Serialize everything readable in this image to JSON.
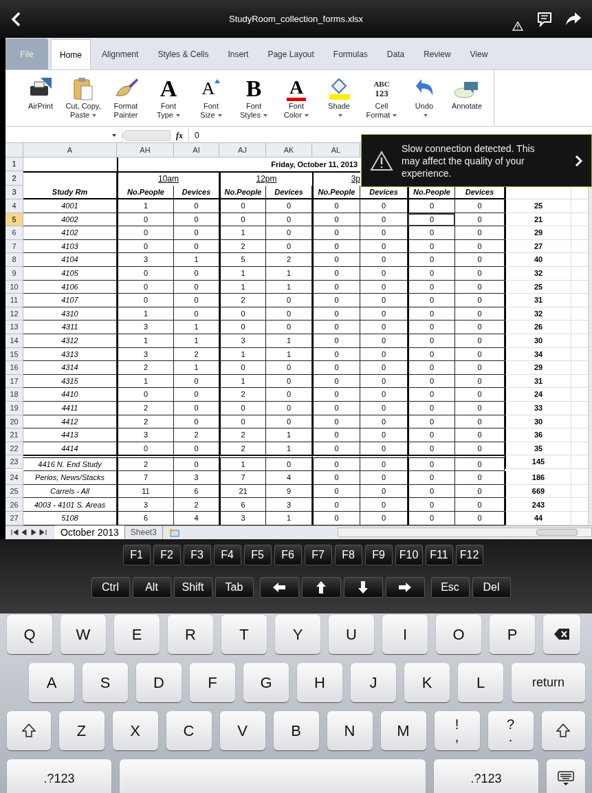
{
  "window": {
    "title": "StudyRoom_collection_forms.xlsx"
  },
  "tabs": [
    {
      "label": "File",
      "kind": "file",
      "selected": false
    },
    {
      "label": "Home",
      "kind": "tab",
      "selected": true
    },
    {
      "label": "Alignment",
      "kind": "tab",
      "selected": false
    },
    {
      "label": "Styles & Cells",
      "kind": "tab",
      "selected": false
    },
    {
      "label": "Insert",
      "kind": "tab",
      "selected": false
    },
    {
      "label": "Page Layout",
      "kind": "tab",
      "selected": false
    },
    {
      "label": "Formulas",
      "kind": "tab",
      "selected": false
    },
    {
      "label": "Data",
      "kind": "tab",
      "selected": false
    },
    {
      "label": "Review",
      "kind": "tab",
      "selected": false
    },
    {
      "label": "View",
      "kind": "tab",
      "selected": false
    }
  ],
  "ribbon": [
    {
      "kind": "printer",
      "lines": [
        "AirPrint"
      ],
      "dropdown": false
    },
    {
      "kind": "clipboard",
      "lines": [
        "Cut, Copy,",
        "Paste"
      ],
      "dropdown": true
    },
    {
      "kind": "brush",
      "lines": [
        "Format",
        "Painter"
      ],
      "dropdown": false
    },
    {
      "kind": "glyph",
      "glyph": "A",
      "lines": [
        "Font",
        "Type"
      ],
      "dropdown": true
    },
    {
      "kind": "size",
      "glyph": "A",
      "lines": [
        "Font",
        "Size"
      ],
      "dropdown": true
    },
    {
      "kind": "glyph",
      "glyph": "B",
      "lines": [
        "Font",
        "Styles"
      ],
      "dropdown": true
    },
    {
      "kind": "color",
      "glyph": "A",
      "lines": [
        "Font",
        "Color"
      ],
      "dropdown": true
    },
    {
      "kind": "shade",
      "lines": [
        "Shade"
      ],
      "dropdown": true
    },
    {
      "kind": "format",
      "glyph": "ABC",
      "glyph2": "123",
      "lines": [
        "Cell",
        "Format"
      ],
      "dropdown": true
    },
    {
      "kind": "undo",
      "lines": [
        "Undo"
      ],
      "dropdown": true
    },
    {
      "kind": "annotate",
      "lines": [
        "Annotate"
      ],
      "dropdown": false
    }
  ],
  "formula_bar": {
    "function_symbol": "fx",
    "value": "0"
  },
  "columns": [
    "A",
    "AH",
    "AI",
    "AJ",
    "AK",
    "AL"
  ],
  "header_rows": [
    {
      "number": "1",
      "title": "Friday, October 11, 2013"
    },
    {
      "number": "2",
      "times": [
        "10am",
        "12pm",
        "3p"
      ]
    },
    {
      "number": "3",
      "room_heading": "Study Rm",
      "headings": [
        "No.People",
        "Devices",
        "No.People",
        "Devices",
        "No.People",
        "Devices",
        "No.People",
        "Devices"
      ]
    }
  ],
  "rows": [
    {
      "number": "4",
      "selected": false,
      "section_start": false,
      "room": "4001",
      "total": "25",
      "cells": [
        {
          "value": "1",
          "selected": false
        },
        {
          "value": "0",
          "selected": false
        },
        {
          "value": "0",
          "selected": false
        },
        {
          "value": "0",
          "selected": false
        },
        {
          "value": "0",
          "selected": false
        },
        {
          "value": "0",
          "selected": false
        },
        {
          "value": "0",
          "selected": false
        },
        {
          "value": "0",
          "selected": false
        }
      ]
    },
    {
      "number": "5",
      "selected": true,
      "section_start": false,
      "room": "4002",
      "total": "21",
      "cells": [
        {
          "value": "0",
          "selected": false
        },
        {
          "value": "0",
          "selected": false
        },
        {
          "value": "0",
          "selected": false
        },
        {
          "value": "0",
          "selected": false
        },
        {
          "value": "0",
          "selected": false
        },
        {
          "value": "0",
          "selected": false
        },
        {
          "value": "0",
          "selected": true
        },
        {
          "value": "0",
          "selected": false
        }
      ]
    },
    {
      "number": "6",
      "selected": false,
      "section_start": false,
      "room": "4102",
      "total": "29",
      "cells": [
        {
          "value": "0",
          "selected": false
        },
        {
          "value": "0",
          "selected": false
        },
        {
          "value": "1",
          "selected": false
        },
        {
          "value": "0",
          "selected": false
        },
        {
          "value": "0",
          "selected": false
        },
        {
          "value": "0",
          "selected": false
        },
        {
          "value": "0",
          "selected": false
        },
        {
          "value": "0",
          "selected": false
        }
      ]
    },
    {
      "number": "7",
      "selected": false,
      "section_start": false,
      "room": "4103",
      "total": "27",
      "cells": [
        {
          "value": "0",
          "selected": false
        },
        {
          "value": "0",
          "selected": false
        },
        {
          "value": "2",
          "selected": false
        },
        {
          "value": "0",
          "selected": false
        },
        {
          "value": "0",
          "selected": false
        },
        {
          "value": "0",
          "selected": false
        },
        {
          "value": "0",
          "selected": false
        },
        {
          "value": "0",
          "selected": false
        }
      ]
    },
    {
      "number": "8",
      "selected": false,
      "section_start": false,
      "room": "4104",
      "total": "40",
      "cells": [
        {
          "value": "3",
          "selected": false
        },
        {
          "value": "1",
          "selected": false
        },
        {
          "value": "5",
          "selected": false
        },
        {
          "value": "2",
          "selected": false
        },
        {
          "value": "0",
          "selected": false
        },
        {
          "value": "0",
          "selected": false
        },
        {
          "value": "0",
          "selected": false
        },
        {
          "value": "0",
          "selected": false
        }
      ]
    },
    {
      "number": "9",
      "selected": false,
      "section_start": false,
      "room": "4105",
      "total": "32",
      "cells": [
        {
          "value": "0",
          "selected": false
        },
        {
          "value": "0",
          "selected": false
        },
        {
          "value": "1",
          "selected": false
        },
        {
          "value": "1",
          "selected": false
        },
        {
          "value": "0",
          "selected": false
        },
        {
          "value": "0",
          "selected": false
        },
        {
          "value": "0",
          "selected": false
        },
        {
          "value": "0",
          "selected": false
        }
      ]
    },
    {
      "number": "10",
      "selected": false,
      "section_start": false,
      "room": "4106",
      "total": "25",
      "cells": [
        {
          "value": "0",
          "selected": false
        },
        {
          "value": "0",
          "selected": false
        },
        {
          "value": "1",
          "selected": false
        },
        {
          "value": "1",
          "selected": false
        },
        {
          "value": "0",
          "selected": false
        },
        {
          "value": "0",
          "selected": false
        },
        {
          "value": "0",
          "selected": false
        },
        {
          "value": "0",
          "selected": false
        }
      ]
    },
    {
      "number": "11",
      "selected": false,
      "section_start": false,
      "room": "4107",
      "total": "31",
      "cells": [
        {
          "value": "0",
          "selected": false
        },
        {
          "value": "0",
          "selected": false
        },
        {
          "value": "2",
          "selected": false
        },
        {
          "value": "0",
          "selected": false
        },
        {
          "value": "0",
          "selected": false
        },
        {
          "value": "0",
          "selected": false
        },
        {
          "value": "0",
          "selected": false
        },
        {
          "value": "0",
          "selected": false
        }
      ]
    },
    {
      "number": "12",
      "selected": false,
      "section_start": false,
      "room": "4310",
      "total": "32",
      "cells": [
        {
          "value": "1",
          "selected": false
        },
        {
          "value": "0",
          "selected": false
        },
        {
          "value": "0",
          "selected": false
        },
        {
          "value": "0",
          "selected": false
        },
        {
          "value": "0",
          "selected": false
        },
        {
          "value": "0",
          "selected": false
        },
        {
          "value": "0",
          "selected": false
        },
        {
          "value": "0",
          "selected": false
        }
      ]
    },
    {
      "number": "13",
      "selected": false,
      "section_start": false,
      "room": "4311",
      "total": "26",
      "cells": [
        {
          "value": "3",
          "selected": false
        },
        {
          "value": "1",
          "selected": false
        },
        {
          "value": "0",
          "selected": false
        },
        {
          "value": "0",
          "selected": false
        },
        {
          "value": "0",
          "selected": false
        },
        {
          "value": "0",
          "selected": false
        },
        {
          "value": "0",
          "selected": false
        },
        {
          "value": "0",
          "selected": false
        }
      ]
    },
    {
      "number": "14",
      "selected": false,
      "section_start": false,
      "room": "4312",
      "total": "30",
      "cells": [
        {
          "value": "1",
          "selected": false
        },
        {
          "value": "1",
          "selected": false
        },
        {
          "value": "3",
          "selected": false
        },
        {
          "value": "1",
          "selected": false
        },
        {
          "value": "0",
          "selected": false
        },
        {
          "value": "0",
          "selected": false
        },
        {
          "value": "0",
          "selected": false
        },
        {
          "value": "0",
          "selected": false
        }
      ]
    },
    {
      "number": "15",
      "selected": false,
      "section_start": false,
      "room": "4313",
      "total": "34",
      "cells": [
        {
          "value": "3",
          "selected": false
        },
        {
          "value": "2",
          "selected": false
        },
        {
          "value": "1",
          "selected": false
        },
        {
          "value": "1",
          "selected": false
        },
        {
          "value": "0",
          "selected": false
        },
        {
          "value": "0",
          "selected": false
        },
        {
          "value": "0",
          "selected": false
        },
        {
          "value": "0",
          "selected": false
        }
      ]
    },
    {
      "number": "16",
      "selected": false,
      "section_start": false,
      "room": "4314",
      "total": "29",
      "cells": [
        {
          "value": "2",
          "selected": false
        },
        {
          "value": "1",
          "selected": false
        },
        {
          "value": "0",
          "selected": false
        },
        {
          "value": "0",
          "selected": false
        },
        {
          "value": "0",
          "selected": false
        },
        {
          "value": "0",
          "selected": false
        },
        {
          "value": "0",
          "selected": false
        },
        {
          "value": "0",
          "selected": false
        }
      ]
    },
    {
      "number": "17",
      "selected": false,
      "section_start": false,
      "room": "4315",
      "total": "31",
      "cells": [
        {
          "value": "1",
          "selected": false
        },
        {
          "value": "0",
          "selected": false
        },
        {
          "value": "1",
          "selected": false
        },
        {
          "value": "0",
          "selected": false
        },
        {
          "value": "0",
          "selected": false
        },
        {
          "value": "0",
          "selected": false
        },
        {
          "value": "0",
          "selected": false
        },
        {
          "value": "0",
          "selected": false
        }
      ]
    },
    {
      "number": "18",
      "selected": false,
      "section_start": false,
      "room": "4410",
      "total": "24",
      "cells": [
        {
          "value": "0",
          "selected": false
        },
        {
          "value": "0",
          "selected": false
        },
        {
          "value": "2",
          "selected": false
        },
        {
          "value": "0",
          "selected": false
        },
        {
          "value": "0",
          "selected": false
        },
        {
          "value": "0",
          "selected": false
        },
        {
          "value": "0",
          "selected": false
        },
        {
          "value": "0",
          "selected": false
        }
      ]
    },
    {
      "number": "19",
      "selected": false,
      "section_start": false,
      "room": "4411",
      "total": "33",
      "cells": [
        {
          "value": "2",
          "selected": false
        },
        {
          "value": "0",
          "selected": false
        },
        {
          "value": "0",
          "selected": false
        },
        {
          "value": "0",
          "selected": false
        },
        {
          "value": "0",
          "selected": false
        },
        {
          "value": "0",
          "selected": false
        },
        {
          "value": "0",
          "selected": false
        },
        {
          "value": "0",
          "selected": false
        }
      ]
    },
    {
      "number": "20",
      "selected": false,
      "section_start": false,
      "room": "4412",
      "total": "30",
      "cells": [
        {
          "value": "2",
          "selected": false
        },
        {
          "value": "0",
          "selected": false
        },
        {
          "value": "0",
          "selected": false
        },
        {
          "value": "0",
          "selected": false
        },
        {
          "value": "0",
          "selected": false
        },
        {
          "value": "0",
          "selected": false
        },
        {
          "value": "0",
          "selected": false
        },
        {
          "value": "0",
          "selected": false
        }
      ]
    },
    {
      "number": "21",
      "selected": false,
      "section_start": false,
      "room": "4413",
      "total": "36",
      "cells": [
        {
          "value": "3",
          "selected": false
        },
        {
          "value": "2",
          "selected": false
        },
        {
          "value": "2",
          "selected": false
        },
        {
          "value": "1",
          "selected": false
        },
        {
          "value": "0",
          "selected": false
        },
        {
          "value": "0",
          "selected": false
        },
        {
          "value": "0",
          "selected": false
        },
        {
          "value": "0",
          "selected": false
        }
      ]
    },
    {
      "number": "22",
      "selected": false,
      "section_start": false,
      "room": "4414",
      "total": "35",
      "cells": [
        {
          "value": "0",
          "selected": false
        },
        {
          "value": "0",
          "selected": false
        },
        {
          "value": "2",
          "selected": false
        },
        {
          "value": "1",
          "selected": false
        },
        {
          "value": "0",
          "selected": false
        },
        {
          "value": "0",
          "selected": false
        },
        {
          "value": "0",
          "selected": false
        },
        {
          "value": "0",
          "selected": false
        }
      ]
    },
    {
      "number": "23",
      "selected": false,
      "section_start": true,
      "room": "4416 N. End Study",
      "total": "145",
      "cells": [
        {
          "value": "2",
          "selected": false
        },
        {
          "value": "0",
          "selected": false
        },
        {
          "value": "1",
          "selected": false
        },
        {
          "value": "0",
          "selected": false
        },
        {
          "value": "0",
          "selected": false
        },
        {
          "value": "0",
          "selected": false
        },
        {
          "value": "0",
          "selected": false
        },
        {
          "value": "0",
          "selected": false
        }
      ]
    },
    {
      "number": "24",
      "selected": false,
      "section_start": false,
      "room": "Perios, News/Stacks",
      "total": "186",
      "cells": [
        {
          "value": "7",
          "selected": false
        },
        {
          "value": "3",
          "selected": false
        },
        {
          "value": "7",
          "selected": false
        },
        {
          "value": "4",
          "selected": false
        },
        {
          "value": "0",
          "selected": false
        },
        {
          "value": "0",
          "selected": false
        },
        {
          "value": "0",
          "selected": false
        },
        {
          "value": "0",
          "selected": false
        }
      ]
    },
    {
      "number": "25",
      "selected": false,
      "section_start": false,
      "room": "Carrels - All",
      "total": "669",
      "cells": [
        {
          "value": "11",
          "selected": false
        },
        {
          "value": "6",
          "selected": false
        },
        {
          "value": "21",
          "selected": false
        },
        {
          "value": "9",
          "selected": false
        },
        {
          "value": "0",
          "selected": false
        },
        {
          "value": "0",
          "selected": false
        },
        {
          "value": "0",
          "selected": false
        },
        {
          "value": "0",
          "selected": false
        }
      ]
    },
    {
      "number": "26",
      "selected": false,
      "section_start": false,
      "room": "4003 - 4101 S. Areas",
      "total": "243",
      "cells": [
        {
          "value": "3",
          "selected": false
        },
        {
          "value": "2",
          "selected": false
        },
        {
          "value": "6",
          "selected": false
        },
        {
          "value": "3",
          "selected": false
        },
        {
          "value": "0",
          "selected": false
        },
        {
          "value": "0",
          "selected": false
        },
        {
          "value": "0",
          "selected": false
        },
        {
          "value": "0",
          "selected": false
        }
      ]
    },
    {
      "number": "27",
      "selected": false,
      "section_start": false,
      "room": "5108",
      "total": "44",
      "cells": [
        {
          "value": "6",
          "selected": false
        },
        {
          "value": "4",
          "selected": false
        },
        {
          "value": "3",
          "selected": false
        },
        {
          "value": "1",
          "selected": false
        },
        {
          "value": "0",
          "selected": false
        },
        {
          "value": "0",
          "selected": false
        },
        {
          "value": "0",
          "selected": false
        },
        {
          "value": "0",
          "selected": false
        }
      ]
    }
  ],
  "sheet_tabs": [
    {
      "label": "October 2013",
      "selected": true
    },
    {
      "label": "Sheet3",
      "selected": false
    }
  ],
  "notification": {
    "text": "Slow connection detected. This may affect the quality of your experience."
  },
  "function_keys": [
    {
      "kind": "text",
      "label": "F1"
    },
    {
      "kind": "text",
      "label": "F2"
    },
    {
      "kind": "text",
      "label": "F3"
    },
    {
      "kind": "text",
      "label": "F4"
    },
    {
      "kind": "text",
      "label": "F5"
    },
    {
      "kind": "text",
      "label": "F6"
    },
    {
      "kind": "text",
      "label": "F7"
    },
    {
      "kind": "text",
      "label": "F8"
    },
    {
      "kind": "text",
      "label": "F9"
    },
    {
      "kind": "text",
      "label": "F10"
    },
    {
      "kind": "text",
      "label": "F11"
    },
    {
      "kind": "text",
      "label": "F12"
    }
  ],
  "control_keys": [
    {
      "kind": "text",
      "label": "Ctrl"
    },
    {
      "kind": "text",
      "label": "Alt"
    },
    {
      "kind": "text",
      "label": "Shift"
    },
    {
      "kind": "text",
      "label": "Tab"
    },
    {
      "kind": "left"
    },
    {
      "kind": "up"
    },
    {
      "kind": "down"
    },
    {
      "kind": "right"
    },
    {
      "kind": "text",
      "label": "Esc"
    },
    {
      "kind": "text",
      "label": "Del"
    }
  ],
  "keyboard": [
    [
      {
        "kind": "char",
        "label": "Q"
      },
      {
        "kind": "char",
        "label": "W"
      },
      {
        "kind": "char",
        "label": "E"
      },
      {
        "kind": "char",
        "label": "R"
      },
      {
        "kind": "char",
        "label": "T"
      },
      {
        "kind": "char",
        "label": "Y"
      },
      {
        "kind": "char",
        "label": "U"
      },
      {
        "kind": "char",
        "label": "I"
      },
      {
        "kind": "char",
        "label": "O"
      },
      {
        "kind": "char",
        "label": "P"
      },
      {
        "kind": "backspace"
      }
    ],
    [
      {
        "kind": "char",
        "label": "A"
      },
      {
        "kind": "char",
        "label": "S"
      },
      {
        "kind": "char",
        "label": "D"
      },
      {
        "kind": "char",
        "label": "F"
      },
      {
        "kind": "char",
        "label": "G"
      },
      {
        "kind": "char",
        "label": "H"
      },
      {
        "kind": "char",
        "label": "J"
      },
      {
        "kind": "char",
        "label": "K"
      },
      {
        "kind": "char",
        "label": "L"
      },
      {
        "kind": "return",
        "label": "return"
      }
    ],
    [
      {
        "kind": "shift"
      },
      {
        "kind": "char",
        "label": "Z"
      },
      {
        "kind": "char",
        "label": "X"
      },
      {
        "kind": "char",
        "label": "C"
      },
      {
        "kind": "char",
        "label": "V"
      },
      {
        "kind": "char",
        "label": "B"
      },
      {
        "kind": "char",
        "label": "N"
      },
      {
        "kind": "char",
        "label": "M"
      },
      {
        "kind": "dual",
        "label": "!",
        "sub": ","
      },
      {
        "kind": "dual",
        "label": "?",
        "sub": "."
      },
      {
        "kind": "shift"
      }
    ],
    [
      {
        "kind": "mode",
        "label": ".?123"
      },
      {
        "kind": "space"
      },
      {
        "kind": "mode",
        "label": ".?123"
      },
      {
        "kind": "hide"
      }
    ]
  ]
}
